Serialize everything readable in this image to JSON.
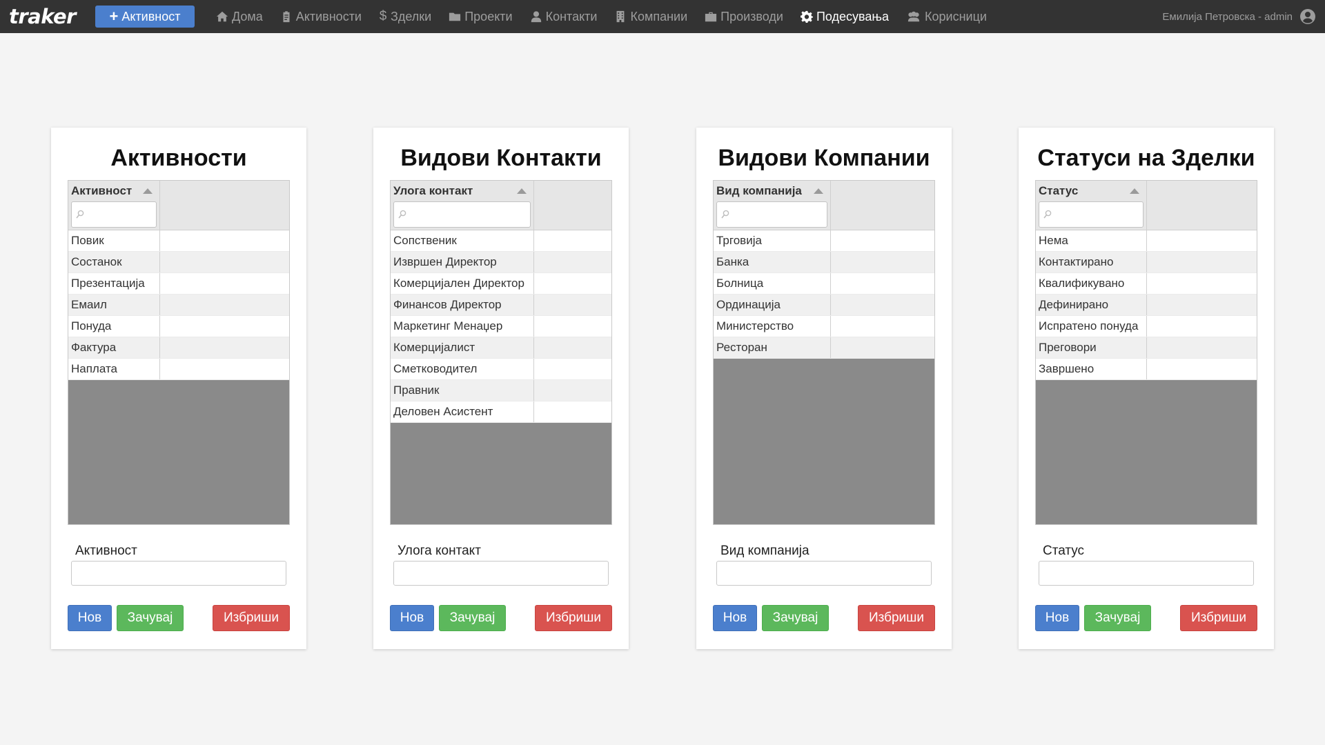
{
  "navbar": {
    "brand": "traker",
    "new_activity_label": "Активност",
    "items": [
      {
        "label": "Дома",
        "icon": "home-icon",
        "active": false
      },
      {
        "label": "Активности",
        "icon": "clipboard-icon",
        "active": false
      },
      {
        "label": "Зделки",
        "icon": "dollar-icon",
        "active": false
      },
      {
        "label": "Проекти",
        "icon": "folder-icon",
        "active": false
      },
      {
        "label": "Контакти",
        "icon": "user-icon",
        "active": false
      },
      {
        "label": "Компании",
        "icon": "building-icon",
        "active": false
      },
      {
        "label": "Производи",
        "icon": "briefcase-icon",
        "active": false
      },
      {
        "label": "Подесувања",
        "icon": "gear-icon",
        "active": true
      },
      {
        "label": "Корисници",
        "icon": "users-icon",
        "active": false
      }
    ],
    "user_label": "Емилија Петровска - admin",
    "user_icon": "user-circle-icon"
  },
  "colors": {
    "navbar_bg": "#333333",
    "primary": "#4b7fcd",
    "success": "#5cb85c",
    "danger": "#d9534f",
    "grid_empty": "#8a8a8a"
  },
  "panels": [
    {
      "title": "Активности",
      "column_header": "Активност",
      "rows": [
        "Повик",
        "Состанок",
        "Презентација",
        "Емаил",
        "Понуда",
        "Фактура",
        "Наплата"
      ],
      "field_label": "Активност",
      "buttons": {
        "new": "Нов",
        "save": "Зачувај",
        "delete": "Избриши"
      }
    },
    {
      "title": "Видови Контакти",
      "column_header": "Улога контакт",
      "rows": [
        "Сопственик",
        "Извршен Директор",
        "Комерцијален Директор",
        "Финансов Директор",
        "Маркетинг Менаџер",
        "Комерцијалист",
        "Сметководител",
        "Правник",
        "Деловен Асистент"
      ],
      "field_label": "Улога контакт",
      "buttons": {
        "new": "Нов",
        "save": "Зачувај",
        "delete": "Избриши"
      }
    },
    {
      "title": "Видови Компании",
      "column_header": "Вид компанија",
      "rows": [
        "Трговија",
        "Банка",
        "Болница",
        "Ординација",
        "Министерство",
        "Ресторан"
      ],
      "field_label": "Вид компанија",
      "buttons": {
        "new": "Нов",
        "save": "Зачувај",
        "delete": "Избриши"
      }
    },
    {
      "title": "Статуси на Зделки",
      "column_header": "Статус",
      "rows": [
        "Нема",
        "Контактирано",
        "Квалификувано",
        "Дефинирано",
        "Испратено понуда",
        "Преговори",
        "Завршено"
      ],
      "field_label": "Статус",
      "buttons": {
        "new": "Нов",
        "save": "Зачувај",
        "delete": "Избриши"
      }
    }
  ]
}
